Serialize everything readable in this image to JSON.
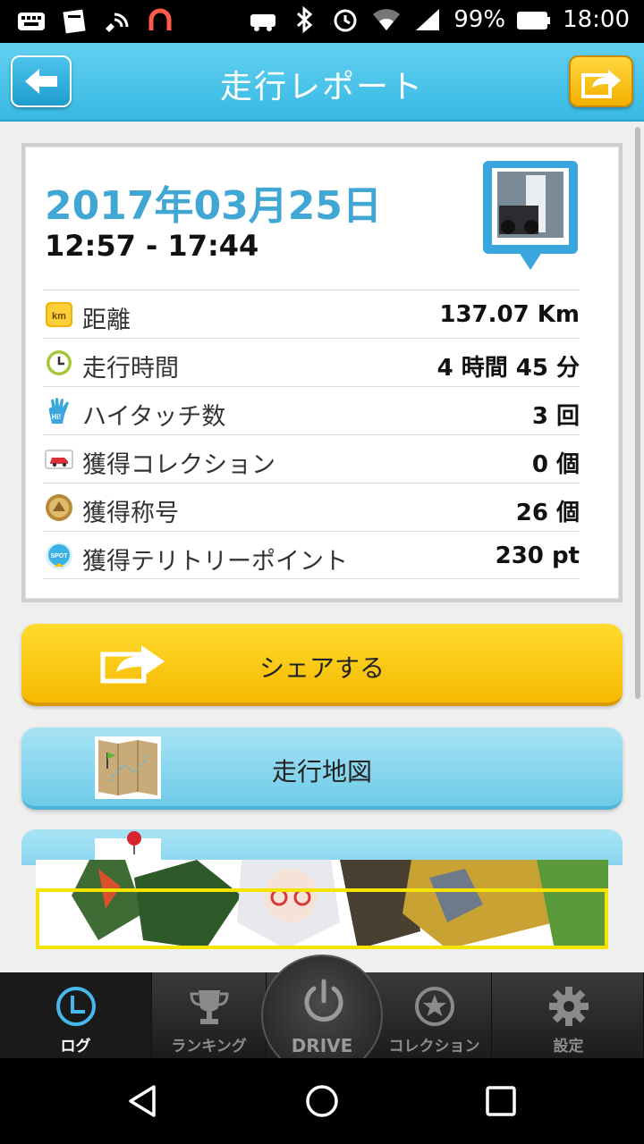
{
  "statusbar": {
    "battery": "99%",
    "time": "18:00"
  },
  "header": {
    "title": "走行レポート"
  },
  "report": {
    "date": "2017年03月25日",
    "time_range": "12:57 - 17:44",
    "rows": [
      {
        "icon": "km-icon",
        "label": "距離",
        "value": "137.07 Km"
      },
      {
        "icon": "clock-icon",
        "label": "走行時間",
        "value": "4 時間 45 分"
      },
      {
        "icon": "hi-five-hand-icon",
        "label": "ハイタッチ数",
        "value": "3 回"
      },
      {
        "icon": "car-card-icon",
        "label": "獲得コレクション",
        "value": "0 個"
      },
      {
        "icon": "medal-icon",
        "label": "獲得称号",
        "value": "26 個"
      },
      {
        "icon": "spot-badge-icon",
        "label": "獲得テリトリーポイント",
        "value": "230 pt"
      }
    ]
  },
  "buttons": {
    "share": "シェアする",
    "map": "走行地図"
  },
  "tabs": {
    "log": "ログ",
    "ranking": "ランキング",
    "drive": "DRIVE",
    "collection": "コレクション",
    "settings": "設定"
  },
  "colors": {
    "accent": "#40a6d4",
    "share_yellow": "#f5b900",
    "map_blue": "#6ecbe8"
  }
}
